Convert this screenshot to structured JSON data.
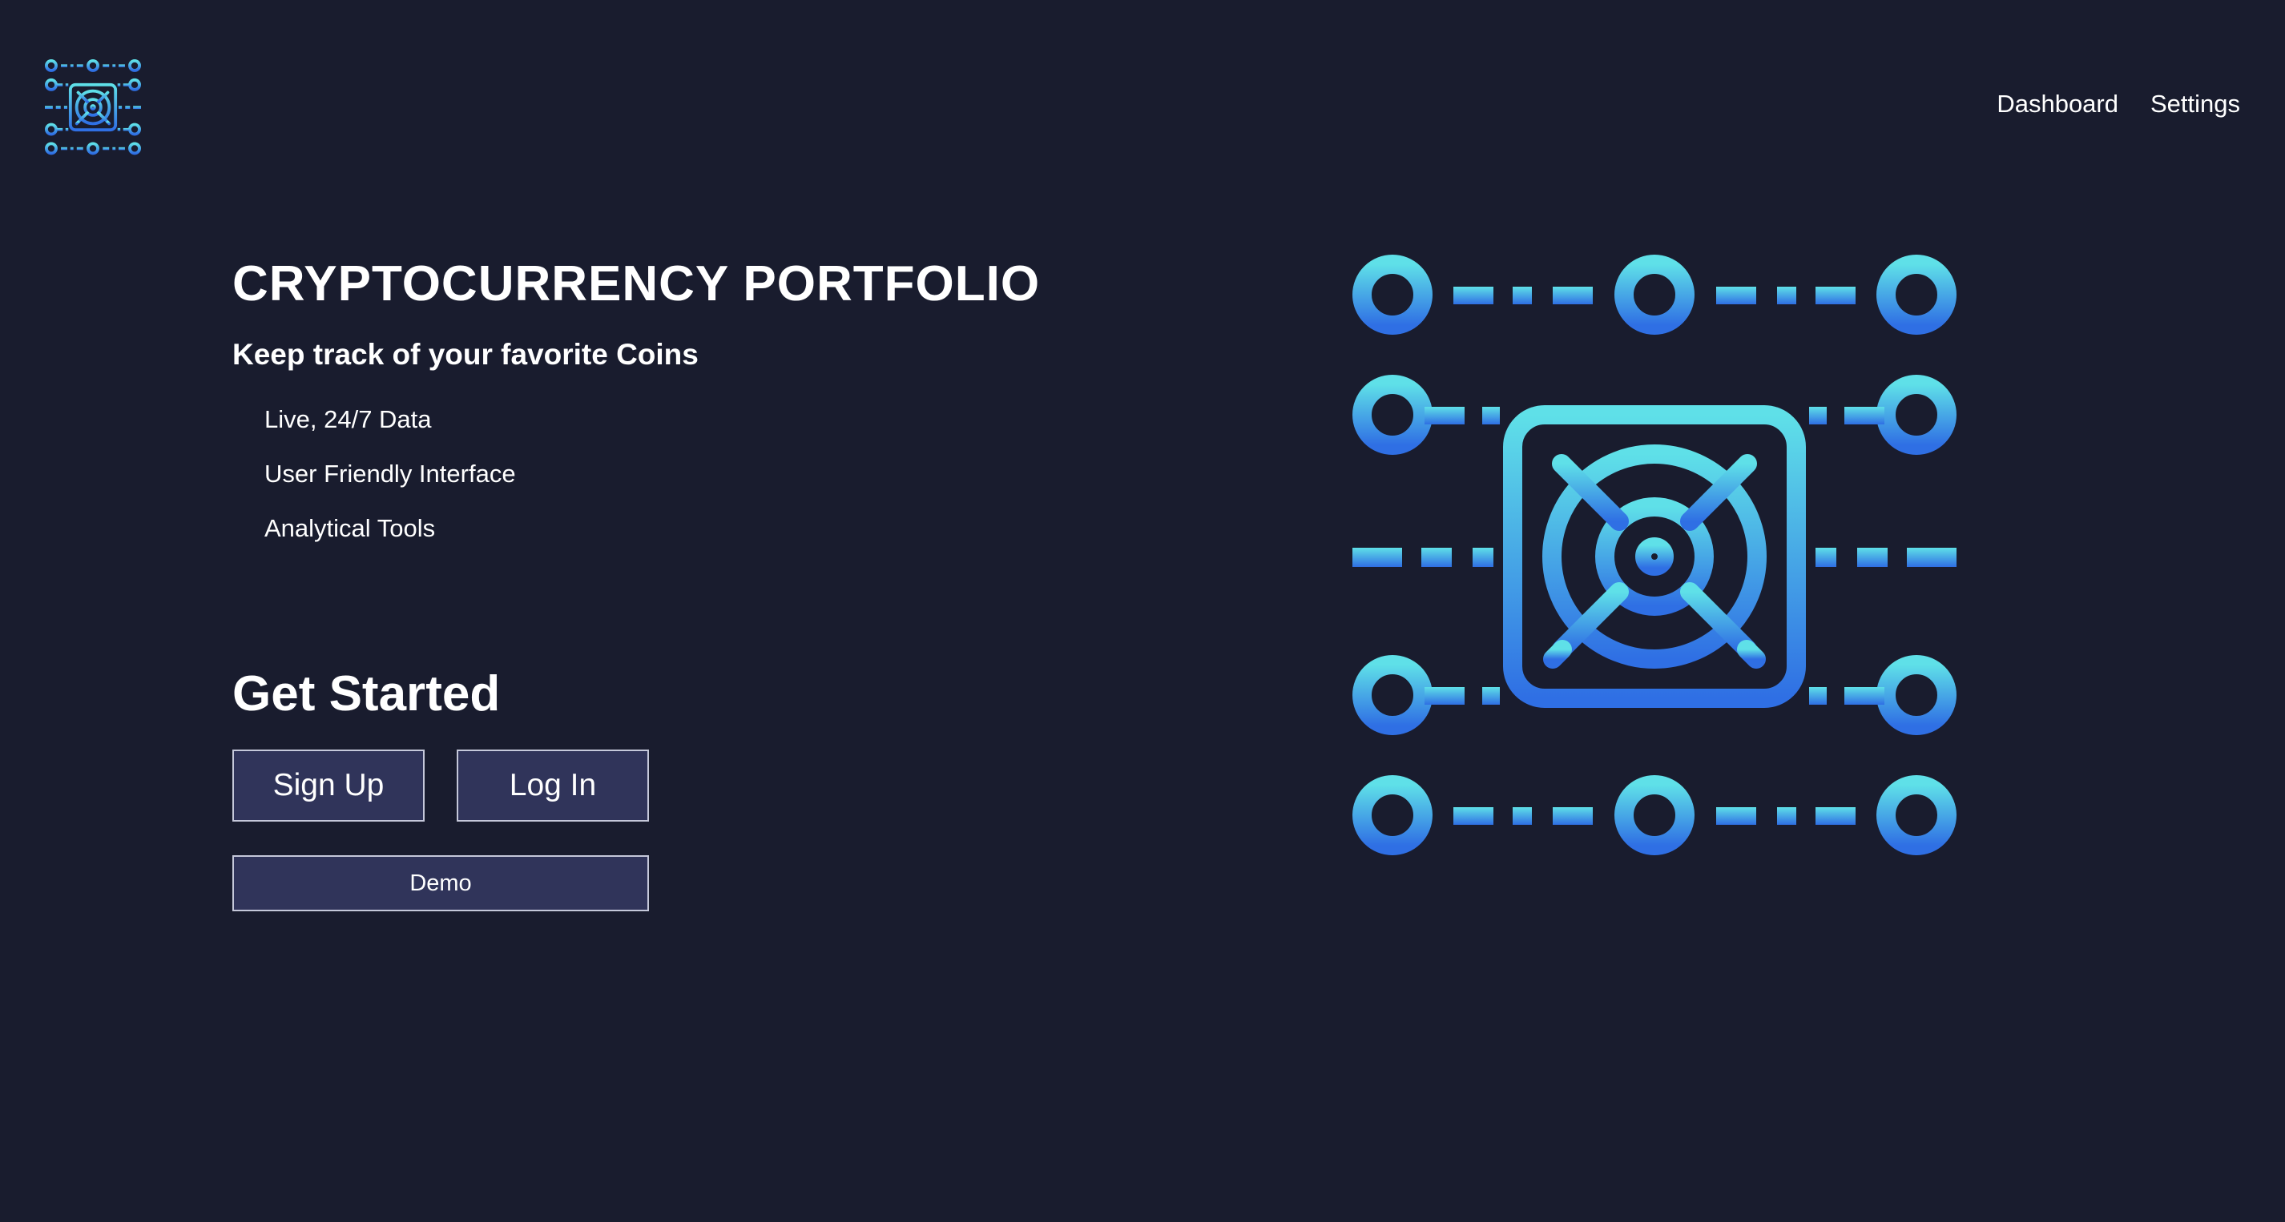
{
  "nav": {
    "items": [
      {
        "label": "Dashboard"
      },
      {
        "label": "Settings"
      }
    ]
  },
  "hero": {
    "title": "CRYPTOCURRENCY PORTFOLIO",
    "subtitle": "Keep track of your favorite Coins",
    "features": [
      "Live, 24/7 Data",
      "User Friendly Interface",
      "Analytical Tools"
    ],
    "get_started": "Get Started",
    "signup_label": "Sign Up",
    "login_label": "Log In",
    "demo_label": "Demo"
  },
  "icons": {
    "logo": "vault-circuit-icon",
    "illustration": "vault-circuit-icon"
  },
  "colors": {
    "background": "#191c2e",
    "button_bg": "#30345a",
    "button_border": "#c5c8da",
    "gradient_top": "#5fe0e8",
    "gradient_bottom": "#2f6fe4"
  }
}
